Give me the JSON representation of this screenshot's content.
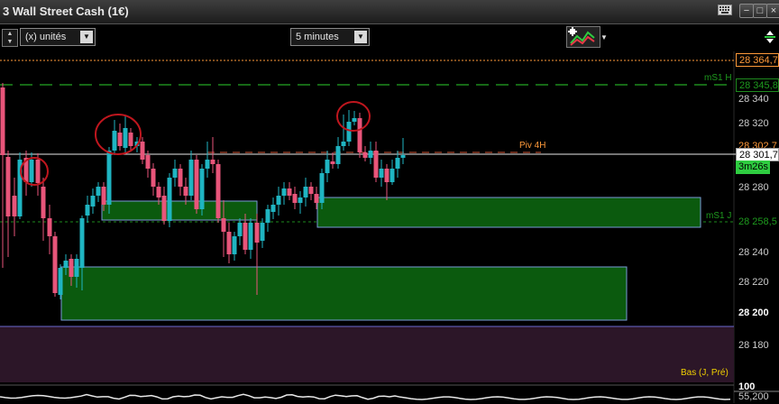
{
  "window": {
    "title": "3  Wall Street Cash (1€)"
  },
  "toolbar": {
    "units_value": "(x) unités",
    "timeframe_value": "5 minutes"
  },
  "chart": {
    "y_ticks": [
      "28 340",
      "28 320",
      "28 280",
      "28 260",
      "28 240",
      "28 220",
      "28 200",
      "28 180"
    ],
    "levels": {
      "orange_top": "28 364,7",
      "ms1h_label": "mS1 H",
      "ms1h_value": "28 345,8",
      "piv4h_label": "Piv 4H",
      "piv4h_value": "28 302,7",
      "current_price": "28 301,7",
      "countdown": "3m26s",
      "ms1j_label": "mS1 J",
      "ms1j_value": "28 258,5",
      "bas_label": "Bas (J, Pré)"
    },
    "indicator": {
      "tick_top": "100",
      "tick_bottom": "55,200"
    },
    "colors": {
      "bull": "#1fb5c2",
      "bear": "#e8557a",
      "zone": "#0b5a0e",
      "bas_zone": "#2c1628",
      "accent_orange": "#ff9a3a",
      "dash_green": "#1e8a1e"
    }
  }
}
